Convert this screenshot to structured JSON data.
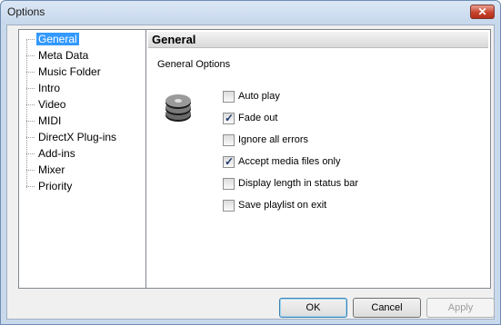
{
  "window": {
    "title": "Options",
    "close_glyph": "✕"
  },
  "tree": {
    "items": [
      {
        "label": "General",
        "selected": true
      },
      {
        "label": "Meta Data",
        "selected": false
      },
      {
        "label": "Music Folder",
        "selected": false
      },
      {
        "label": "Intro",
        "selected": false
      },
      {
        "label": "Video",
        "selected": false
      },
      {
        "label": "MIDI",
        "selected": false
      },
      {
        "label": "DirectX Plug-ins",
        "selected": false
      },
      {
        "label": "Add-ins",
        "selected": false
      },
      {
        "label": "Mixer",
        "selected": false
      },
      {
        "label": "Priority",
        "selected": false
      }
    ]
  },
  "panel": {
    "header": "General",
    "section_label": "General Options",
    "icon": "disk-stack-icon",
    "options": [
      {
        "label": "Auto play",
        "checked": false
      },
      {
        "label": "Fade out",
        "checked": true
      },
      {
        "label": "Ignore all errors",
        "checked": false
      },
      {
        "label": "Accept media files only",
        "checked": true
      },
      {
        "label": "Display length in status bar",
        "checked": false
      },
      {
        "label": "Save playlist on exit",
        "checked": false
      }
    ]
  },
  "buttons": {
    "ok": "OK",
    "cancel": "Cancel",
    "apply": "Apply"
  },
  "colors": {
    "selection": "#3399ff",
    "close_button": "#c8452f"
  }
}
